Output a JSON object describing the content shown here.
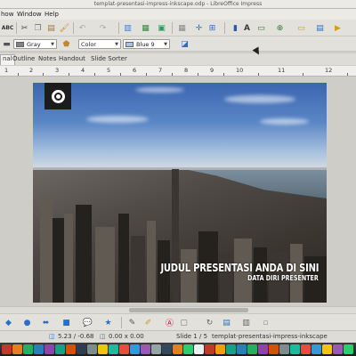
{
  "window": {
    "title": "templat-presentasi-impress-inkscape.odp - LibreOffice Impress"
  },
  "menu": [
    "how",
    "Window",
    "Help"
  ],
  "toolbar1": {
    "icons": [
      "spellcheck-icon",
      "cut-icon",
      "copy-icon",
      "paste-icon",
      "clone-format-icon",
      "undo-icon",
      "redo-icon",
      "chart-icon",
      "table-icon",
      "image-icon",
      "grid-icon",
      "crossing-icon",
      "helplines-icon",
      "shadow-icon",
      "text-icon",
      "slide-layout-icon",
      "new-slide-icon",
      "display-views-icon",
      "master-slide-icon",
      "slideshow-icon"
    ]
  },
  "toolbar2": {
    "line_style": "",
    "line_color": "Gray",
    "area_style": "Color",
    "area_color": "Blue 9",
    "colors": {
      "gray": "#808080",
      "blue9": "#a8c3e8"
    }
  },
  "tabs": [
    "nal",
    "Outline",
    "Notes",
    "Handout",
    "Slide Sorter"
  ],
  "ruler": {
    "numbers": [
      "1",
      "2",
      "3",
      "4",
      "5",
      "6",
      "7",
      "8",
      "9",
      "10",
      "11",
      "12"
    ]
  },
  "slide": {
    "title": "JUDUL PRESENTASI ANDA DI SINI",
    "subtitle": "DATA DIRI PRESENTER"
  },
  "drawbar": {
    "icons": [
      "shapes-icon",
      "circle-icon",
      "arrows-icon",
      "flowchart-icon",
      "callouts-icon",
      "stars-icon",
      "points-icon",
      "glue-icon",
      "fontwork-icon",
      "extrusion-icon",
      "rotate-icon",
      "align-icon",
      "arrange-icon",
      "select-icon"
    ]
  },
  "status": {
    "position": "5.23 / -0.68",
    "size": "0.00 x 0.00",
    "slide": "Slide 1 / 5",
    "master": "templat-presentasi-impress-inkscape"
  },
  "taskbar": {
    "apps": [
      "#c0392b",
      "#e67e22",
      "#27ae60",
      "#2980b9",
      "#8e44ad",
      "#16a085",
      "#d35400",
      "#2c3e50",
      "#7f8c8d",
      "#f1c40f",
      "#1abc9c",
      "#e74c3c",
      "#3498db",
      "#9b59b6",
      "#95a5a6",
      "#34495e",
      "#e67e22",
      "#2ecc71",
      "#ecf0f1",
      "#c0392b",
      "#f39c12",
      "#16a085",
      "#2980b9",
      "#27ae60",
      "#8e44ad",
      "#d35400",
      "#7f8c8d",
      "#1abc9c",
      "#e74c3c",
      "#3498db",
      "#f1c40f",
      "#9b59b6",
      "#2ecc71"
    ]
  }
}
